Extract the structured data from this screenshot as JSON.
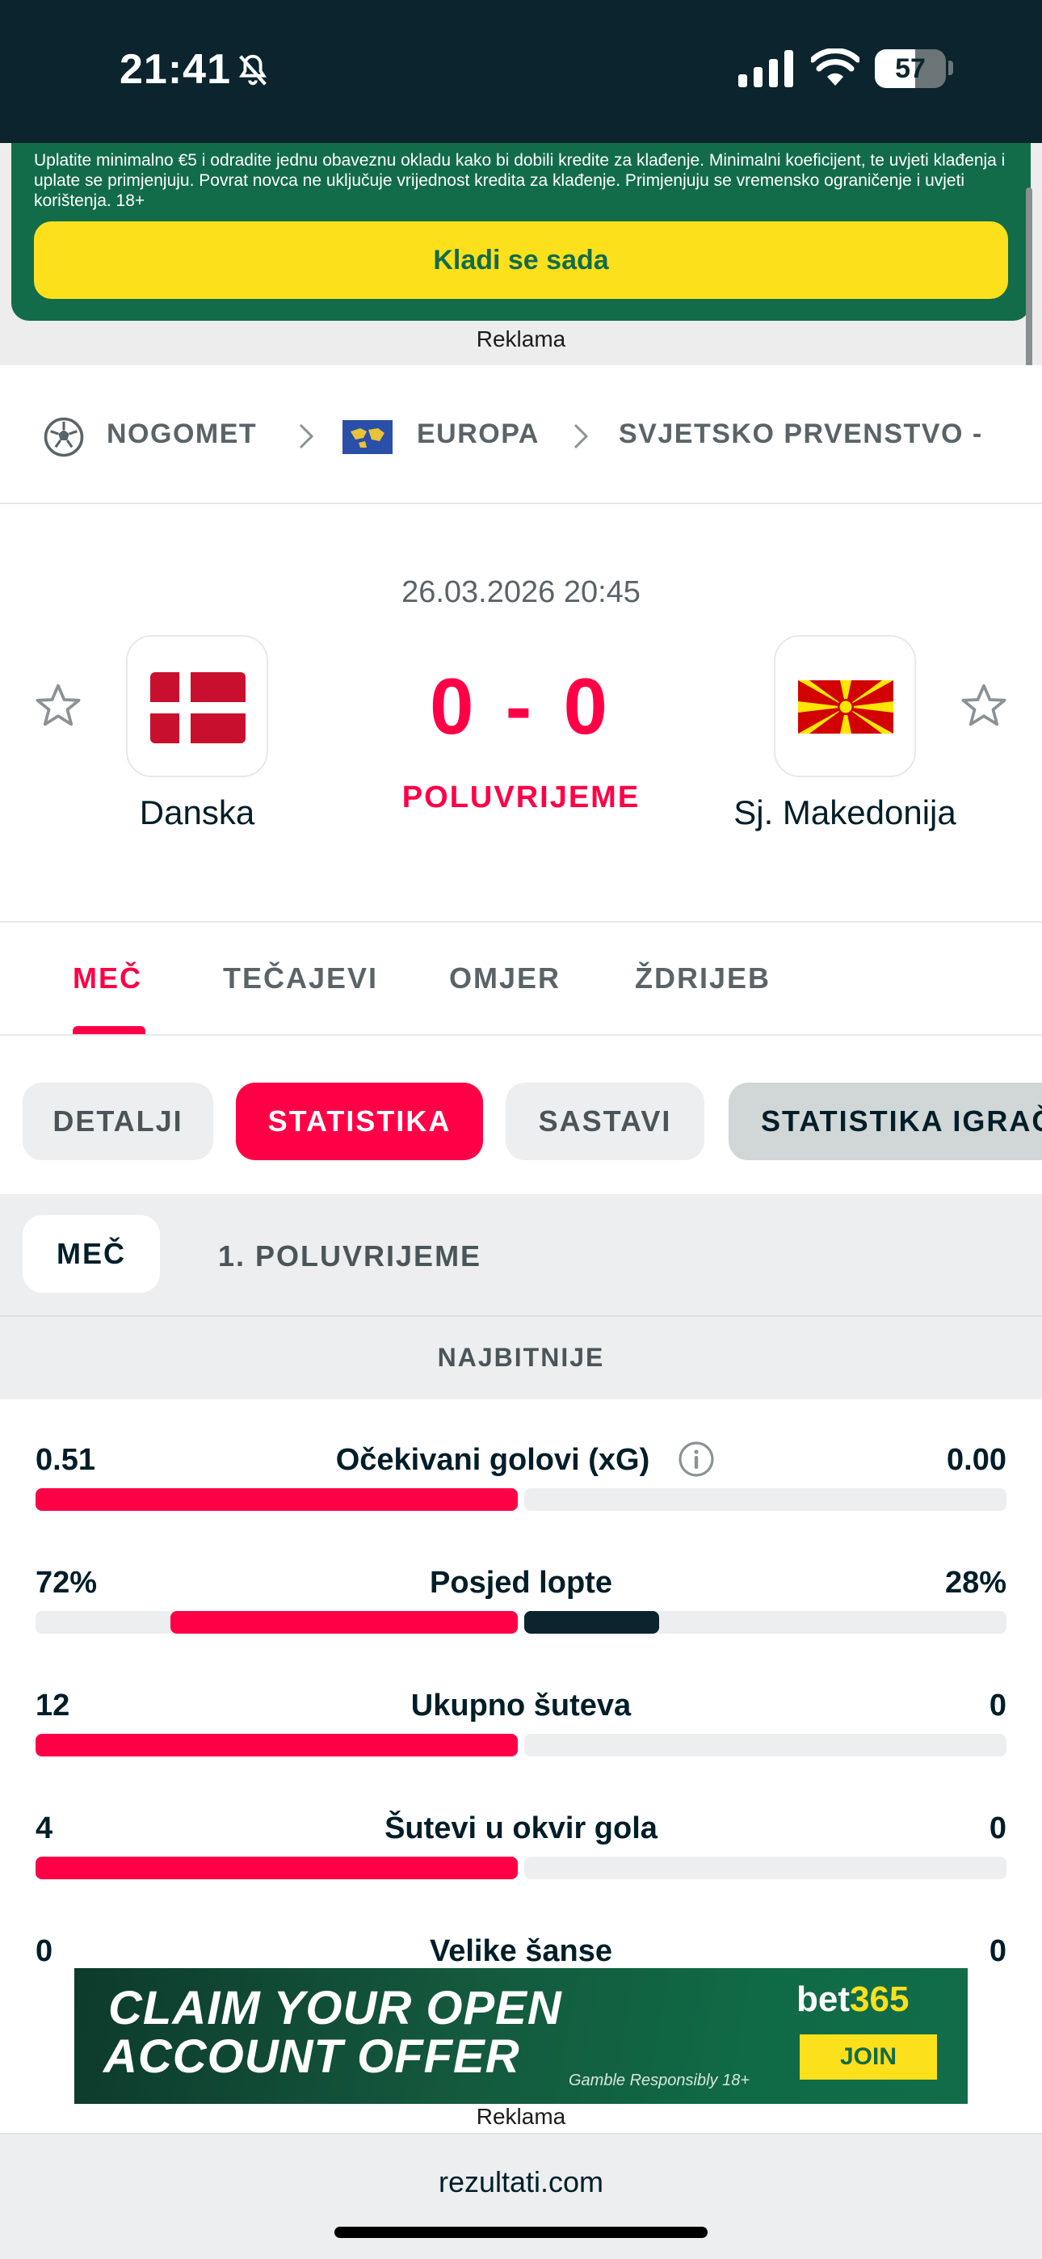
{
  "status_bar": {
    "time": "21:41",
    "battery": "57",
    "battery_level": 0.57
  },
  "promo": {
    "text": "Uplatite minimalno €5 i odradite jednu obaveznu okladu kako bi dobili kredite za klađenje. Minimalni koeficijent, te uvjeti klađenja i uplate se primjenjuju. Povrat novca ne uključuje vrijednost kredita za klađenje. Primjenjuju se vremensko ograničenje i uvjeti korištenja. 18+",
    "button": "Kladi se sada",
    "ad_label": "Reklama"
  },
  "breadcrumb": {
    "sport": "NOGOMET",
    "region": "EUROPA",
    "competition": "SVJETSKO PRVENSTVO -"
  },
  "match": {
    "date": "26.03.2026 20:45",
    "home_team": "Danska",
    "away_team": "Sj. Makedonija",
    "score": "0 - 0",
    "status": "POLUVRIJEME"
  },
  "tabs": [
    {
      "label": "MEČ",
      "active": true
    },
    {
      "label": "TEČAJEVI",
      "active": false
    },
    {
      "label": "OMJER",
      "active": false
    },
    {
      "label": "ŽDRIJEB",
      "active": false
    }
  ],
  "pills": [
    {
      "label": "DETALJI",
      "active": false
    },
    {
      "label": "STATISTIKA",
      "active": true
    },
    {
      "label": "SASTAVI",
      "active": false
    },
    {
      "label": "STATISTIKA IGRAČ",
      "active": false
    }
  ],
  "sub_tabs": [
    {
      "label": "MEČ",
      "active": true
    },
    {
      "label": "1. POLUVRIJEME",
      "active": false
    }
  ],
  "section": "NAJBITNIJE",
  "stats": [
    {
      "label": "Očekivani golovi (xG)",
      "home": "0.51",
      "away": "0.00",
      "home_share": 1.0,
      "away_share": 0.0,
      "info": true
    },
    {
      "label": "Posjed lopte",
      "home": "72%",
      "away": "28%",
      "home_share": 0.72,
      "away_share": 0.28,
      "info": false
    },
    {
      "label": "Ukupno šuteva",
      "home": "12",
      "away": "0",
      "home_share": 1.0,
      "away_share": 0.0,
      "info": false
    },
    {
      "label": "Šutevi u okvir gola",
      "home": "4",
      "away": "0",
      "home_share": 1.0,
      "away_share": 0.0,
      "info": false
    },
    {
      "label": "Velike šanse",
      "home": "0",
      "away": "0",
      "home_share": 0.0,
      "away_share": 0.0,
      "info": false
    }
  ],
  "ad": {
    "line1": "CLAIM YOUR OPEN",
    "line2": "ACCOUNT OFFER",
    "brand_a": "bet",
    "brand_b": "365",
    "join": "JOIN",
    "fine_print": "Gamble Responsibly  18+",
    "label": "Reklama"
  },
  "footer": {
    "url": "rezultati.com"
  },
  "colors": {
    "accent": "#ff0046",
    "dark": "#0b242e",
    "promo_green": "#126c4a",
    "promo_yellow": "#fde01c"
  },
  "icons": [
    "bell-slash-icon",
    "signal-icon",
    "wifi-icon",
    "battery-icon",
    "soccer-ball-icon",
    "europe-flag-icon",
    "chevron-right-icon",
    "star-icon",
    "info-icon"
  ]
}
